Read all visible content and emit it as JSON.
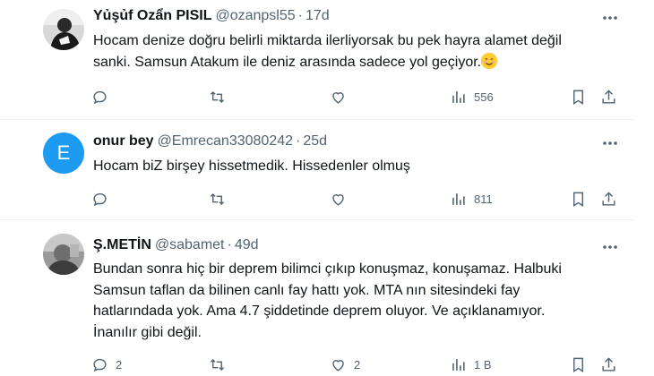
{
  "tweets": [
    {
      "name": "Yủşủf Ozẩn PISIL",
      "handle": "@ozanpsl55",
      "sep": "·",
      "time": "17d",
      "text1": "Hocam denize doğru belirli miktarda ilerliyorsak bu pek hayra alamet değil",
      "text2": "sanki. Samsun Atakum ile deniz arasında sadece yol geçiyor.",
      "views": "556",
      "replies": "",
      "likes": ""
    },
    {
      "name": "onur bey",
      "handle": "@Emrecan33080242",
      "sep": "·",
      "time": "25d",
      "avatar_letter": "E",
      "text1": "Hocam biZ birşey hissetmedik. Hissedenler olmuş",
      "views": "811",
      "replies": "",
      "likes": ""
    },
    {
      "name": "Ş.METİN",
      "handle": "@sabamet",
      "sep": "·",
      "time": "49d",
      "text1": "Bundan sonra hiç bir deprem bilimci çıkıp konuşmaz, konuşamaz. Halbuki",
      "text2": "Samsun taflan da bilinen canlı fay hattı yok. MTA nın sitesindeki fay",
      "text3": "hatlarındada yok. Ama 4.7 şiddetinde deprem oluyor. Ve açıklanamıyor.",
      "text4": "İnanılır gibi değil.",
      "views": "1 B",
      "replies": "2",
      "likes": "2"
    }
  ],
  "icons": [
    "reply-icon",
    "retweet-icon",
    "like-icon",
    "views-icon",
    "bookmark-icon",
    "share-icon",
    "more-icon"
  ],
  "colors": {
    "text": "#0f1419",
    "muted": "#536471",
    "accent": "#1d9bf0",
    "divider": "#eff3f4"
  }
}
